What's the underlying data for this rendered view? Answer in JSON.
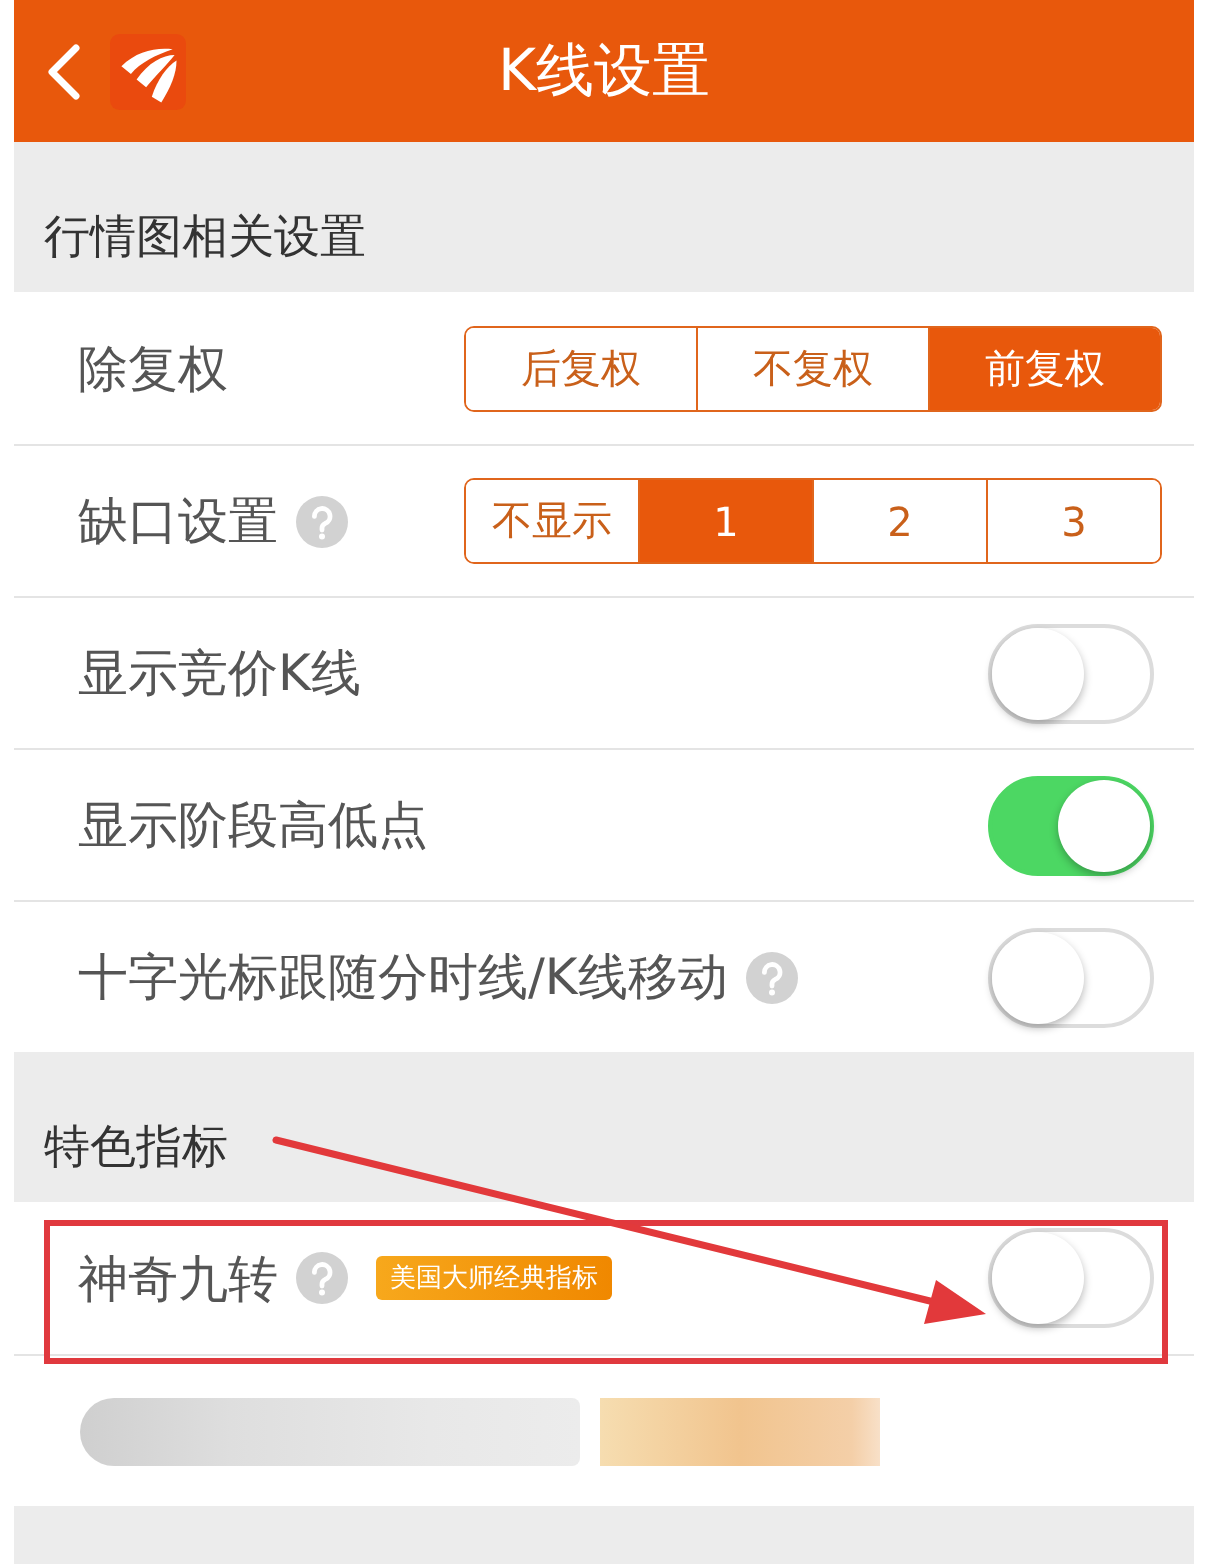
{
  "header": {
    "title": "K线设置"
  },
  "sections": [
    {
      "title": "行情图相关设置",
      "rows": [
        {
          "kind": "segmented",
          "label": "除复权",
          "help": false,
          "highlighted": false,
          "options": [
            {
              "label": "后复权",
              "selected": false
            },
            {
              "label": "不复权",
              "selected": false
            },
            {
              "label": "前复权",
              "selected": true
            }
          ]
        },
        {
          "kind": "segmented",
          "label": "缺口设置",
          "help": true,
          "highlighted": false,
          "options": [
            {
              "label": "不显示",
              "selected": false
            },
            {
              "label": "1",
              "selected": true
            },
            {
              "label": "2",
              "selected": false
            },
            {
              "label": "3",
              "selected": false
            }
          ]
        },
        {
          "kind": "toggle",
          "label": "显示竞价K线",
          "help": false,
          "highlighted": false,
          "on": false
        },
        {
          "kind": "toggle",
          "label": "显示阶段高低点",
          "help": false,
          "highlighted": false,
          "on": true
        },
        {
          "kind": "toggle",
          "label": "十字光标跟随分时线/K线移动",
          "help": true,
          "highlighted": false,
          "on": false
        }
      ]
    },
    {
      "title": "特色指标",
      "rows": [
        {
          "kind": "toggle",
          "label": "神奇九转",
          "help": true,
          "badge": "美国大师经典指标",
          "highlighted": true,
          "on": false
        },
        {
          "kind": "redacted",
          "highlighted": false
        }
      ]
    }
  ]
}
